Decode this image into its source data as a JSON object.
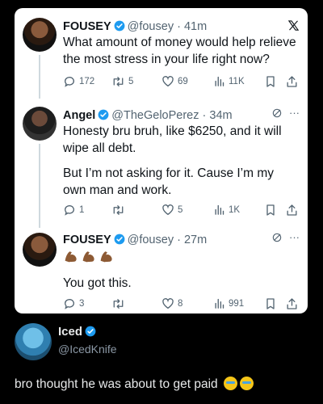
{
  "tweets": [
    {
      "name": "FOUSEY",
      "handle": "@fousey",
      "time": "· 41m",
      "text": "What amount of money would help relieve the most stress in your life right now?",
      "replies": "172",
      "retweets": "5",
      "likes": "69",
      "views": "11K",
      "brand_icon": "x-logo-icon"
    },
    {
      "name": "Angel",
      "handle": "@TheGeloPerez",
      "time": "· 34m",
      "text_p1": "Honesty bru bruh, like $6250, and it will wipe all debt.",
      "text_p2": "But I’m not asking for it. Cause I’m my own man and work.",
      "replies": "1",
      "retweets": "",
      "likes": "5",
      "views": "1K"
    },
    {
      "name": "FOUSEY",
      "handle": "@fousey",
      "time": "· 27m",
      "text": "You got this.",
      "emojis": "flexed-biceps ×3",
      "replies": "3",
      "retweets": "",
      "likes": "8",
      "views": "991"
    }
  ],
  "footer": {
    "name": "Iced",
    "handle": "@IcedKnife",
    "caption": "bro thought he was about to get paid",
    "caption_emojis": "loudly-crying ×2"
  },
  "colors": {
    "verified": "#1d9bf0",
    "muted": "#536471",
    "text": "#0f1419",
    "background": "#000000",
    "card": "#ffffff"
  }
}
